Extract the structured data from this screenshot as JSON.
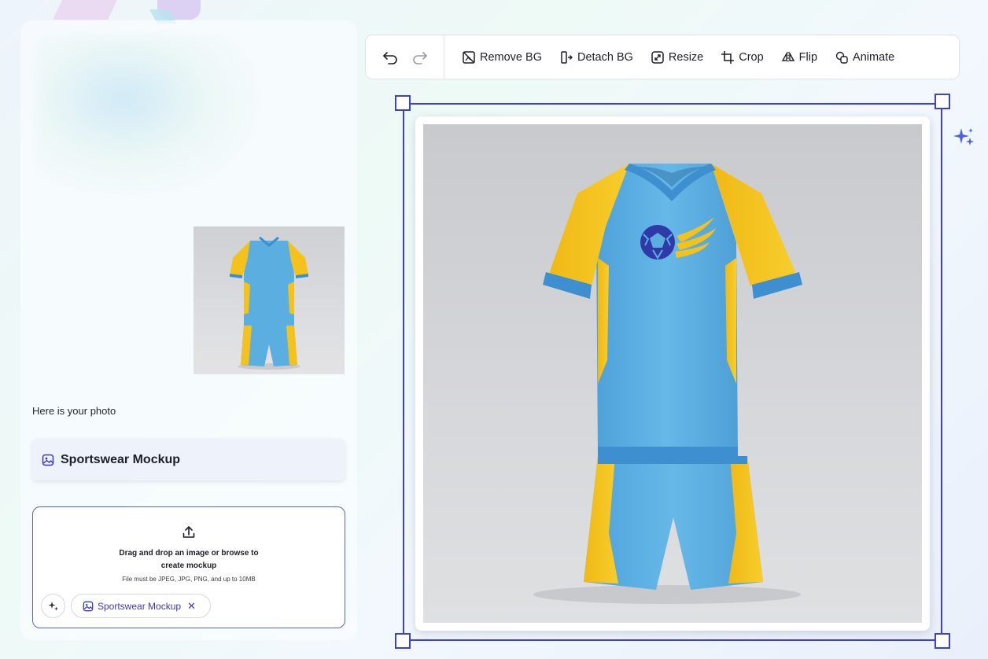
{
  "chat": {
    "message": "Here is your photo",
    "template_card_label": "Sportswear Mockup"
  },
  "upload": {
    "title": "Drag and drop an image or browse to create mockup",
    "note": "File must be JPEG, JPG, PNG, and up to 10MB",
    "chip_label": "Sportswear Mockup",
    "chip_close": "✕"
  },
  "toolbar": {
    "undo_icon": "undo-icon",
    "redo_icon": "redo-icon",
    "tools": [
      {
        "label": "Remove BG",
        "icon": "remove-bg-icon"
      },
      {
        "label": "Detach BG",
        "icon": "detach-bg-icon"
      },
      {
        "label": "Resize",
        "icon": "resize-icon"
      },
      {
        "label": "Crop",
        "icon": "crop-icon"
      },
      {
        "label": "Flip",
        "icon": "flip-icon"
      },
      {
        "label": "Animate",
        "icon": "animate-icon"
      }
    ]
  },
  "colors": {
    "accent": "#3d3fd9",
    "chip_text": "#3a37c4",
    "jersey_blue": "#5aaee0",
    "jersey_yellow": "#f5c21b",
    "logo_navy": "#2f3aa8"
  }
}
